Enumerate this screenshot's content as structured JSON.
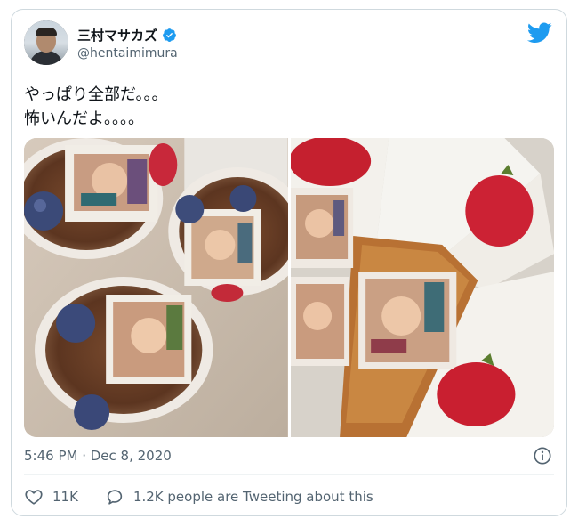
{
  "user": {
    "display_name": "三村マサカズ",
    "handle": "@hentaimimura"
  },
  "tweet": {
    "lines": [
      "やっぱり全部だ。。。",
      "怖いんだよ。。。。"
    ],
    "timestamp": "5:46 PM · Dec 8, 2020"
  },
  "actions": {
    "likes": "11K",
    "retweet_label": "1.2K people are Tweeting about this"
  },
  "icons": {
    "verified": "verified-badge-icon",
    "brand": "twitter-bird-icon",
    "info": "info-icon",
    "like": "heart-icon",
    "reply": "speech-bubble-icon"
  },
  "colors": {
    "brand_blue": "#1d9bf0",
    "secondary_text": "#536471",
    "border": "#cfd9de"
  },
  "media": {
    "photo_count": 2
  }
}
